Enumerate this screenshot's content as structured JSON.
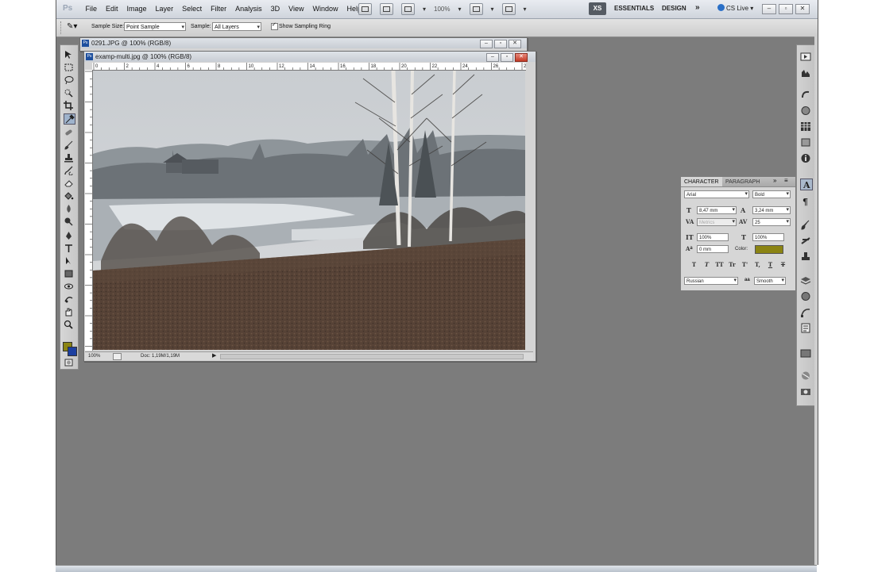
{
  "app": {
    "logo": "Ps",
    "menus": [
      "File",
      "Edit",
      "Image",
      "Layer",
      "Select",
      "Filter",
      "Analysis",
      "3D",
      "View",
      "Window",
      "Help"
    ],
    "zoom_dropdown": "100%",
    "workspace_switcher": "XS",
    "workspaces": [
      "ESSENTIALS",
      "DESIGN"
    ],
    "cs_live": "CS Live"
  },
  "options_bar": {
    "sample_size_label": "Sample Size:",
    "sample_size_value": "Point Sample",
    "sample_label": "Sample:",
    "sample_value": "All Layers",
    "show_sampling_ring_label": "Show Sampling Ring",
    "show_sampling_ring_checked": true
  },
  "documents": {
    "back": {
      "title": "0291.JPG @ 100% (RGB/8)"
    },
    "front": {
      "title": "examp-multi.jpg @ 100% (RGB/8)",
      "zoom": "100%",
      "doc_info": "Doc: 1,19M/1,19M",
      "ruler_ticks": [
        "0",
        "2",
        "4",
        "6",
        "8",
        "10",
        "12",
        "14",
        "16",
        "18",
        "20",
        "22",
        "24",
        "26",
        "2"
      ]
    }
  },
  "character_panel": {
    "tabs": [
      "CHARACTER",
      "PARAGRAPH"
    ],
    "font_family": "Arial",
    "font_style": "Bold",
    "font_size": "8,47 mm",
    "leading": "3,24 mm",
    "kerning": "Metrics",
    "tracking": "25",
    "vertical_scale": "100%",
    "horizontal_scale": "100%",
    "baseline_shift": "0 mm",
    "color_label": "Color:",
    "color": "#8b8413",
    "style_buttons": [
      "T",
      "T",
      "TT",
      "Tr",
      "T'",
      "T,",
      "T",
      "T"
    ],
    "language": "Russian",
    "anti_alias_label": "aa",
    "anti_alias": "Smooth"
  },
  "colors": {
    "foreground": "#8b8413",
    "background": "#1c3fa0"
  }
}
